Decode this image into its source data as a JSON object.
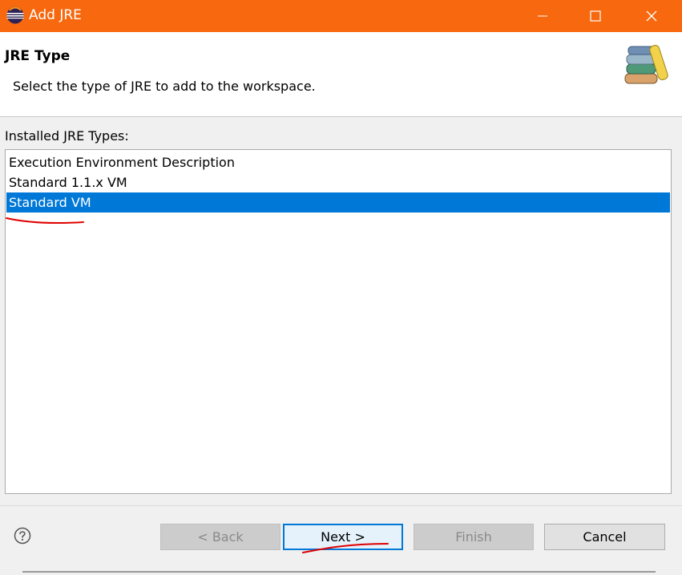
{
  "window": {
    "title": "Add JRE",
    "titlebar_color": "#f7680f",
    "icons": {
      "app": "eclipse-icon",
      "minimize": "minimize-icon",
      "maximize": "maximize-icon",
      "close": "close-icon"
    }
  },
  "banner": {
    "title": "JRE Type",
    "description": "Select the type of JRE to add to the workspace.",
    "icon": "books-icon"
  },
  "jre_types": {
    "label": "Installed JRE Types:",
    "items": [
      "Execution Environment Description",
      "Standard 1.1.x VM",
      "Standard VM"
    ],
    "selected": "Standard VM",
    "selection_color": "#0078d7"
  },
  "buttons": {
    "help_icon": "help-icon",
    "back": "< Back",
    "next": "Next >",
    "finish": "Finish",
    "cancel": "Cancel"
  },
  "annotations": {
    "marker_color": "#e00000"
  }
}
